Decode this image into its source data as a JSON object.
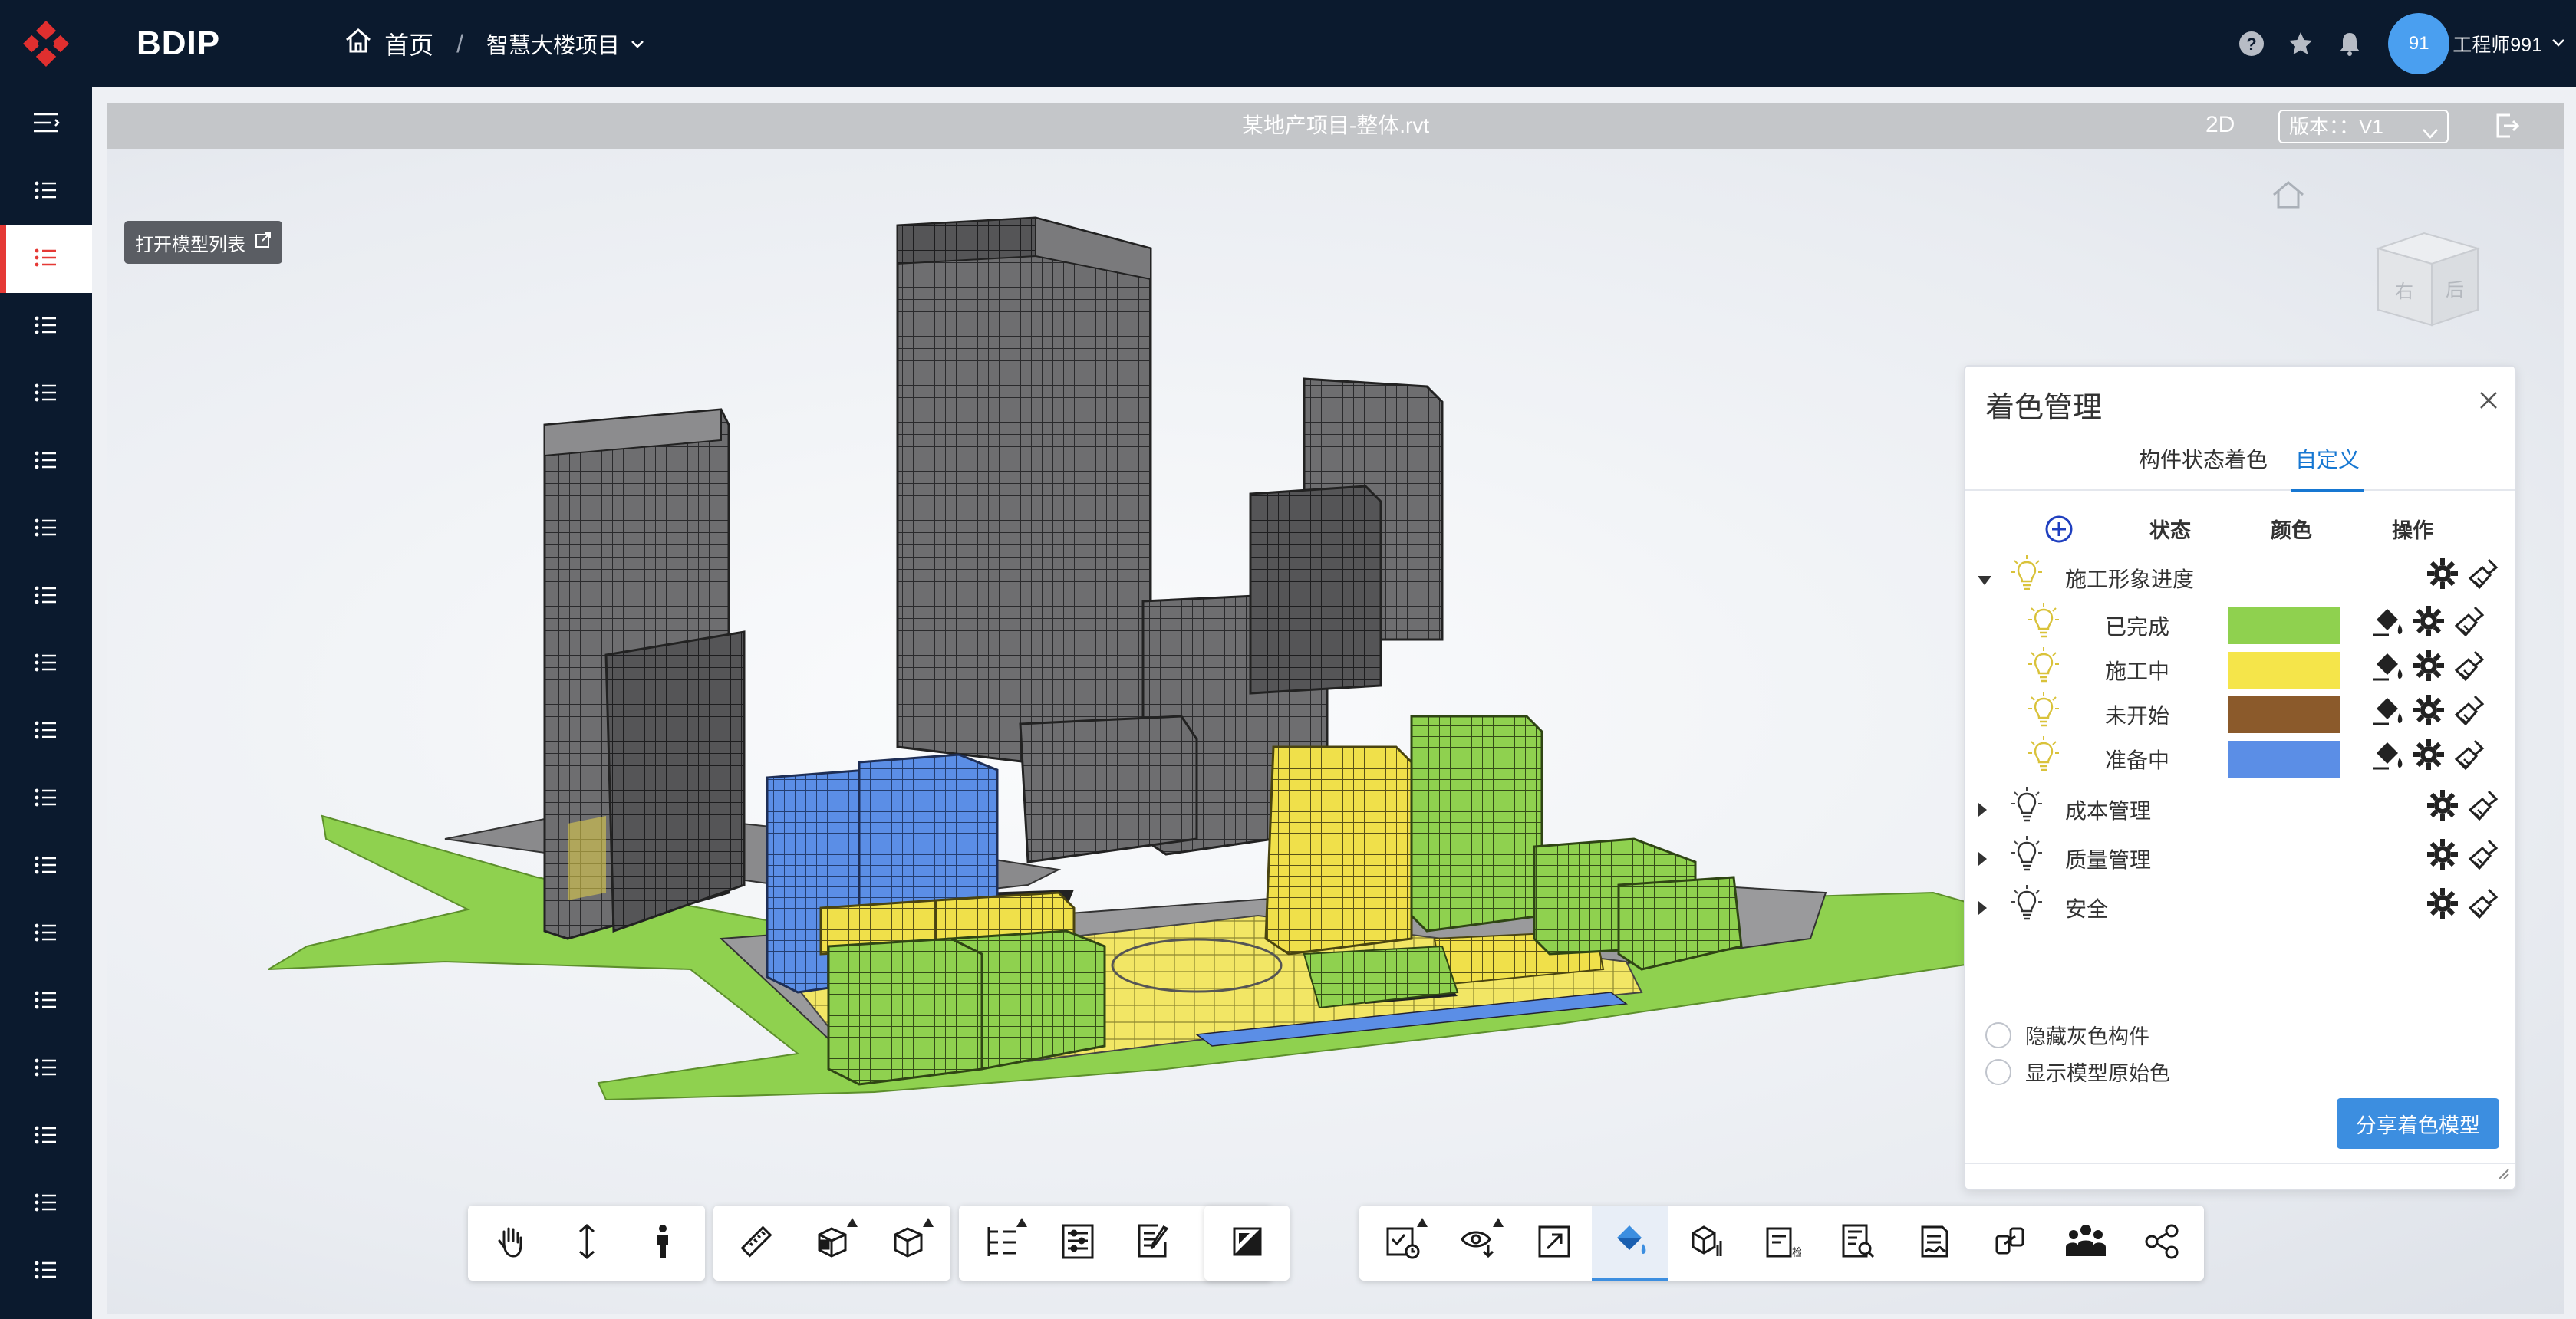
{
  "app": {
    "brand": "BDIP",
    "logo_icon": "bdip-logo-icon"
  },
  "breadcrumb": {
    "home": "首页",
    "separator": "/",
    "project": "智慧大楼项目"
  },
  "user": {
    "avatar_text": "91",
    "name": "工程师991"
  },
  "sidebar": {
    "items": [
      "menu-1",
      "menu-2",
      "menu-3",
      "menu-4",
      "menu-5",
      "menu-6",
      "menu-7",
      "menu-8",
      "menu-9",
      "menu-10",
      "menu-11",
      "menu-12",
      "menu-13",
      "menu-14",
      "menu-15",
      "menu-16",
      "menu-17"
    ],
    "active_index": 1
  },
  "viewer": {
    "file_title": "某地产项目-整体.rvt",
    "mode_2d": "2D",
    "version_label": "版本：：V1",
    "open_model_list": "打开模型列表",
    "viewcube": {
      "right": "右",
      "back": "后"
    }
  },
  "panel": {
    "title": "着色管理",
    "tabs": [
      "构件状态着色",
      "自定义"
    ],
    "active_tab": 1,
    "headers": {
      "state": "状态",
      "color": "颜色",
      "action": "操作"
    },
    "groups": [
      {
        "label": "施工形象进度",
        "expanded": true,
        "children": [
          {
            "label": "已完成",
            "color": "#8fd14f"
          },
          {
            "label": "施工中",
            "color": "#f5e54a"
          },
          {
            "label": "未开始",
            "color": "#8b5a2b"
          },
          {
            "label": "准备中",
            "color": "#5b8ee6"
          }
        ]
      },
      {
        "label": "成本管理",
        "expanded": false
      },
      {
        "label": "质量管理",
        "expanded": false
      },
      {
        "label": "安全",
        "expanded": false
      }
    ],
    "options": [
      "隐藏灰色构件",
      "显示模型原始色"
    ],
    "share_button": "分享着色模型"
  },
  "toolbar": {
    "groups": [
      [
        "hand-pan-icon",
        "move-vertical-icon",
        "person-walk-icon"
      ],
      [
        "ruler-measure-icon",
        "section-box-icon",
        "cube-icon"
      ],
      [
        "tree-structure-icon",
        "properties-list-icon",
        "edit-list-icon",
        "settings-gear-icon"
      ],
      [
        "fullscreen-icon"
      ],
      [
        "schedule-check-icon",
        "eye-download-icon",
        "zoom-fit-icon",
        "paint-bucket-icon",
        "model-chart-icon",
        "inspection-doc-icon",
        "search-list-icon",
        "sign-doc-icon",
        "link-icon",
        "team-icon",
        "share-icon"
      ]
    ]
  },
  "colors": {
    "nav_bg": "#0b1a2e",
    "accent_red": "#e53935",
    "accent_blue": "#1677d2",
    "completed": "#8fd14f",
    "in_progress": "#f5e54a",
    "not_started": "#8b5a2b",
    "preparing": "#5b8ee6"
  }
}
